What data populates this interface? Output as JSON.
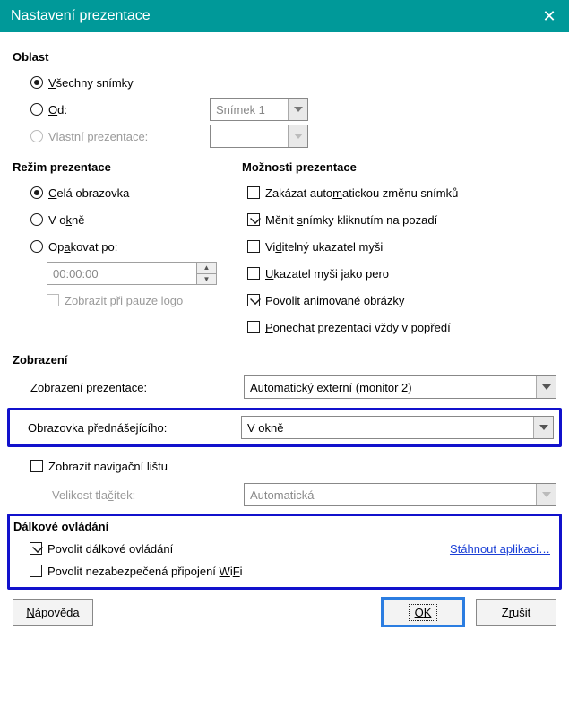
{
  "titlebar": {
    "title": "Nastavení prezentace",
    "close": "✕"
  },
  "range": {
    "title": "Oblast",
    "all_pre": "",
    "all_u": "V",
    "all_post": "šechny snímky",
    "from_pre": "",
    "from_u": "O",
    "from_post": "d:",
    "from_value": "Snímek 1",
    "custom_pre": "Vlastní ",
    "custom_u": "p",
    "custom_post": "rezentace:",
    "custom_value": ""
  },
  "mode": {
    "title": "Režim prezentace",
    "full_u": "C",
    "full_post": "elá obrazovka",
    "win_pre": "V o",
    "win_u": "k",
    "win_post": "ně",
    "loop_pre": "Op",
    "loop_u": "a",
    "loop_post": "kovat po:",
    "duration": "00:00:00",
    "pause_pre": "Zobrazit při pauze ",
    "pause_u": "l",
    "pause_post": "ogo"
  },
  "opts": {
    "title": "Možnosti prezentace",
    "o1_pre": "Zakázat auto",
    "o1_u": "m",
    "o1_post": "atickou změnu snímků",
    "o2_pre": "Měnit ",
    "o2_u": "s",
    "o2_post": "nímky kliknutím na pozadí",
    "o3_pre": "Vi",
    "o3_u": "d",
    "o3_post": "itelný ukazatel myši",
    "o4_u": "U",
    "o4_post": "kazatel myši jako pero",
    "o5_pre": "Povolit ",
    "o5_u": "a",
    "o5_post": "nimované obrázky",
    "o6_u": "P",
    "o6_post": "onechat prezentaci vždy v popředí"
  },
  "display": {
    "title": "Zobrazení",
    "pres_label_u": "Z",
    "pres_label_post": "obrazení prezentace:",
    "pres_value": "Automatický externí (monitor 2)",
    "speaker_label": "Obrazovka přednášejícího:",
    "speaker_value": "V okně",
    "navbar_pre": "Zobrazit navi",
    "navbar_u": "g",
    "navbar_post": "ační lištu",
    "btnsize_pre": "Velikost tla",
    "btnsize_u": "č",
    "btnsize_post": "ítek:",
    "btnsize_value": "Automatická"
  },
  "remote": {
    "title": "Dálkové ovládání",
    "enable": "Povolit dálkové ovládání",
    "download": "Stáhnout aplikaci…",
    "wifi_pre": "Povolit nezabezpečená připojení ",
    "wifi_u": "W",
    "wifi_mid": "i",
    "wifi_u2": "F",
    "wifi_post": "i"
  },
  "buttons": {
    "help_u": "N",
    "help_post": "ápověda",
    "ok_u": "O",
    "ok_u2": "K",
    "cancel_pre": "Z",
    "cancel_u": "r",
    "cancel_post": "ušit"
  }
}
